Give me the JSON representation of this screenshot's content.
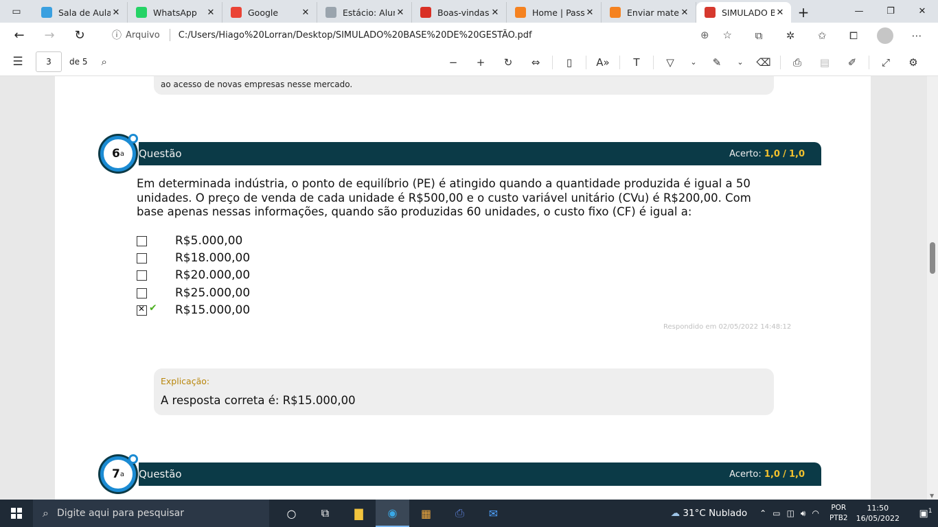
{
  "tabs": [
    {
      "title": "Sala de Aula |",
      "favicon": "estacio-icon",
      "color": "#3aa0e0"
    },
    {
      "title": "WhatsApp",
      "favicon": "whatsapp-icon",
      "color": "#25d366"
    },
    {
      "title": "Google",
      "favicon": "google-icon",
      "color": "#ea4335"
    },
    {
      "title": "Estácio: Aluno",
      "favicon": "brain-icon",
      "color": "#9aa4ad"
    },
    {
      "title": "Boas-vindas a",
      "favicon": "gmail-icon",
      "color": "#d93025"
    },
    {
      "title": "Home | Passe",
      "favicon": "passei-icon",
      "color": "#f58220"
    },
    {
      "title": "Enviar materi",
      "favicon": "passei-icon",
      "color": "#f58220"
    },
    {
      "title": "SIMULADO B",
      "favicon": "pdf-icon",
      "color": "#d6392e"
    }
  ],
  "address": {
    "scheme_label": "Arquivo",
    "url": "C:/Users/Hiago%20Lorran/Desktop/SIMULADO%20BASE%20DE%20GESTÃO.pdf"
  },
  "pdf_toolbar": {
    "current_page": "3",
    "total_pages": "de 5"
  },
  "previous_question": {
    "tail_text": "ao acesso de novas empresas nesse mercado."
  },
  "question6": {
    "number": "6",
    "number_suffix": "a",
    "label": "Questão",
    "score_label": "Acerto:",
    "score_value": "1,0",
    "score_sep": "/",
    "score_max": "1,0",
    "text": "Em determinada indústria, o ponto de equilíbrio (PE) é atingido quando a quantidade produzida é igual a 50 unidades. O preço de venda de cada unidade é R$500,00 e o custo variável unitário (CVu) é R$200,00. Com base apenas nessas informações, quando são produzidas 60 unidades, o custo fixo (CF) é igual a:",
    "options": [
      {
        "label": "R$5.000,00",
        "checked": false
      },
      {
        "label": "R$18.000,00",
        "checked": false
      },
      {
        "label": "R$20.000,00",
        "checked": false
      },
      {
        "label": "R$25.000,00",
        "checked": false
      },
      {
        "label": "R$15.000,00",
        "checked": true,
        "correct": true
      }
    ],
    "answered_at": "Respondido em 02/05/2022 14:48:12",
    "explanation_title": "Explicação:",
    "explanation_text": "A resposta correta é: R$15.000,00"
  },
  "question7": {
    "number": "7",
    "number_suffix": "a",
    "label": "Questão",
    "score_label": "Acerto:",
    "score_value": "1,0",
    "score_sep": "/",
    "score_max": "1,0"
  },
  "taskbar": {
    "search_placeholder": "Digite aqui para pesquisar",
    "weather": "31°C  Nublado",
    "lang_top": "POR",
    "lang_bottom": "PTB2",
    "time": "11:50",
    "date": "16/05/2022",
    "notifications": "1"
  }
}
